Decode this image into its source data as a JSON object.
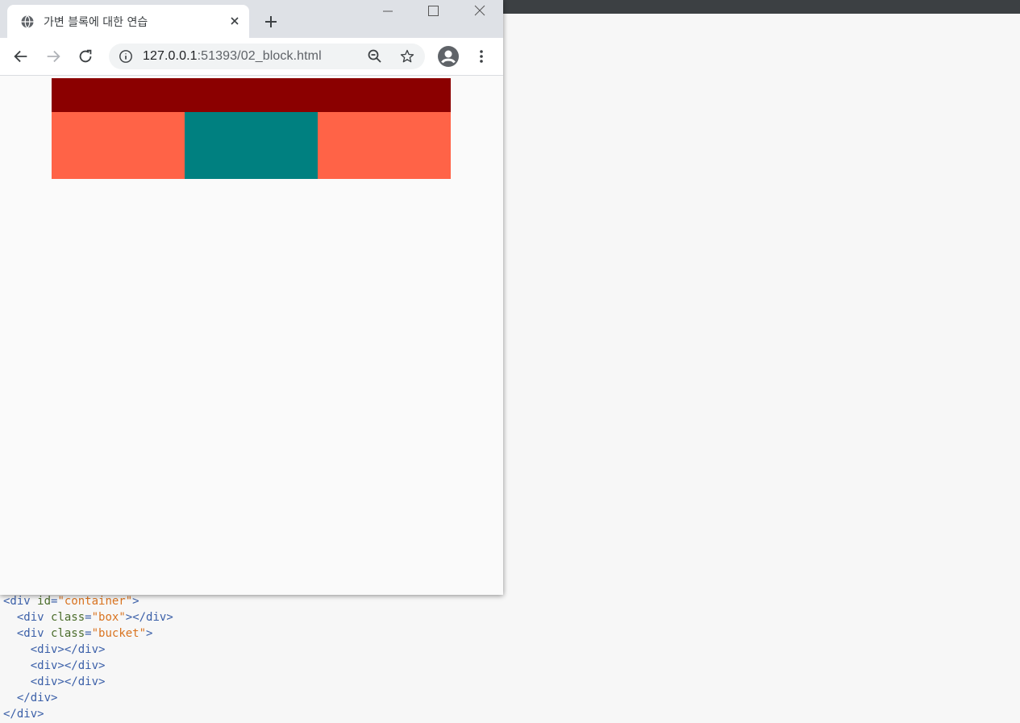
{
  "tab": {
    "title": "가변 블록에 대한 연습"
  },
  "address": {
    "host": "127.0.0.1",
    "path": ":51393/02_block.html"
  },
  "page": {
    "box_color": "#8b0000",
    "bucket_colors": [
      "#ff6347",
      "#008080",
      "#ff6347"
    ]
  },
  "code_lines": [
    [
      {
        "t": "<div "
      },
      {
        "t": "id",
        "c": "attr"
      },
      {
        "t": "="
      },
      {
        "t": "\"container\"",
        "c": "val"
      },
      {
        "t": ">"
      }
    ],
    [
      {
        "t": "  <div "
      },
      {
        "t": "class",
        "c": "attr"
      },
      {
        "t": "="
      },
      {
        "t": "\"box\"",
        "c": "val"
      },
      {
        "t": "></div>"
      }
    ],
    [
      {
        "t": "  <div "
      },
      {
        "t": "class",
        "c": "attr"
      },
      {
        "t": "="
      },
      {
        "t": "\"bucket\"",
        "c": "val"
      },
      {
        "t": ">"
      }
    ],
    [
      {
        "t": "    <div></div>"
      }
    ],
    [
      {
        "t": "    <div></div>"
      }
    ],
    [
      {
        "t": "    <div></div>"
      }
    ],
    [
      {
        "t": "  </div>"
      }
    ],
    [
      {
        "t": "</div>"
      }
    ]
  ]
}
